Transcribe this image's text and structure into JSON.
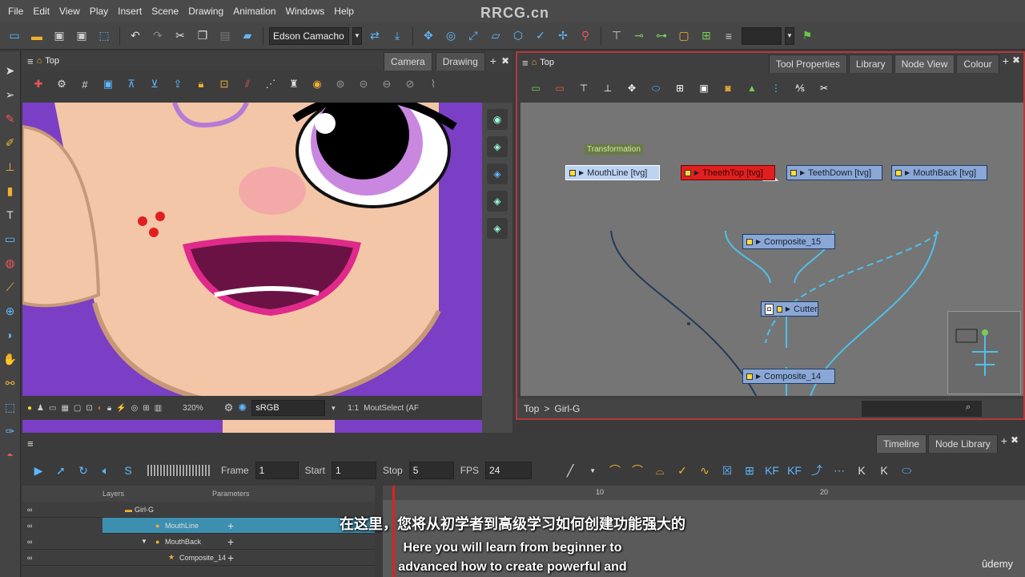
{
  "menu": [
    "File",
    "Edit",
    "View",
    "Play",
    "Insert",
    "Scene",
    "Drawing",
    "Animation",
    "Windows",
    "Help"
  ],
  "watermark": "RRCG.cn",
  "toolbar": {
    "user": "Edson Camacho"
  },
  "camera_panel": {
    "breadcrumb": "Top",
    "tabs": [
      "Camera",
      "Drawing"
    ],
    "zoom": "320%",
    "color_space": "sRGB",
    "ratio": "1:1",
    "selection": "MoutSelect (AF"
  },
  "node_panel": {
    "breadcrumb": "Top",
    "tabs": [
      "Tool Properties",
      "Library",
      "Node View",
      "Colour"
    ],
    "path_root": "Top",
    "path_sep": ">",
    "path_child": "Girl-G",
    "nodes": {
      "transformation_label": "Transformation",
      "mouthline": "MouthLine [tvg]",
      "theethtop": "TheethTop [tvg]",
      "teethdown": "TeethDown [tvg]",
      "mouthback": "MouthBack [tvg]",
      "composite15": "Composite_15",
      "cutter": "Cutter",
      "composite14": "Composite_14"
    }
  },
  "timeline": {
    "tabs": [
      "Timeline",
      "Node Library"
    ],
    "frame_label": "Frame",
    "frame_value": "1",
    "start_label": "Start",
    "start_value": "1",
    "stop_label": "Stop",
    "stop_value": "5",
    "fps_label": "FPS",
    "fps_value": "24",
    "layers_header": "Layers",
    "params_header": "Parameters",
    "ruler_marks": [
      "10",
      "20"
    ],
    "layers": [
      {
        "name": "Girl-G"
      },
      {
        "name": "MouthLine"
      },
      {
        "name": "MouthBack"
      },
      {
        "name": "Composite_14"
      }
    ]
  },
  "subtitles": {
    "zh": "在这里，您将从初学者到高级学习如何创建功能强大的",
    "en1": "Here you will learn from beginner to",
    "en2": "advanced how to create powerful and"
  },
  "brand": "ûdemy"
}
